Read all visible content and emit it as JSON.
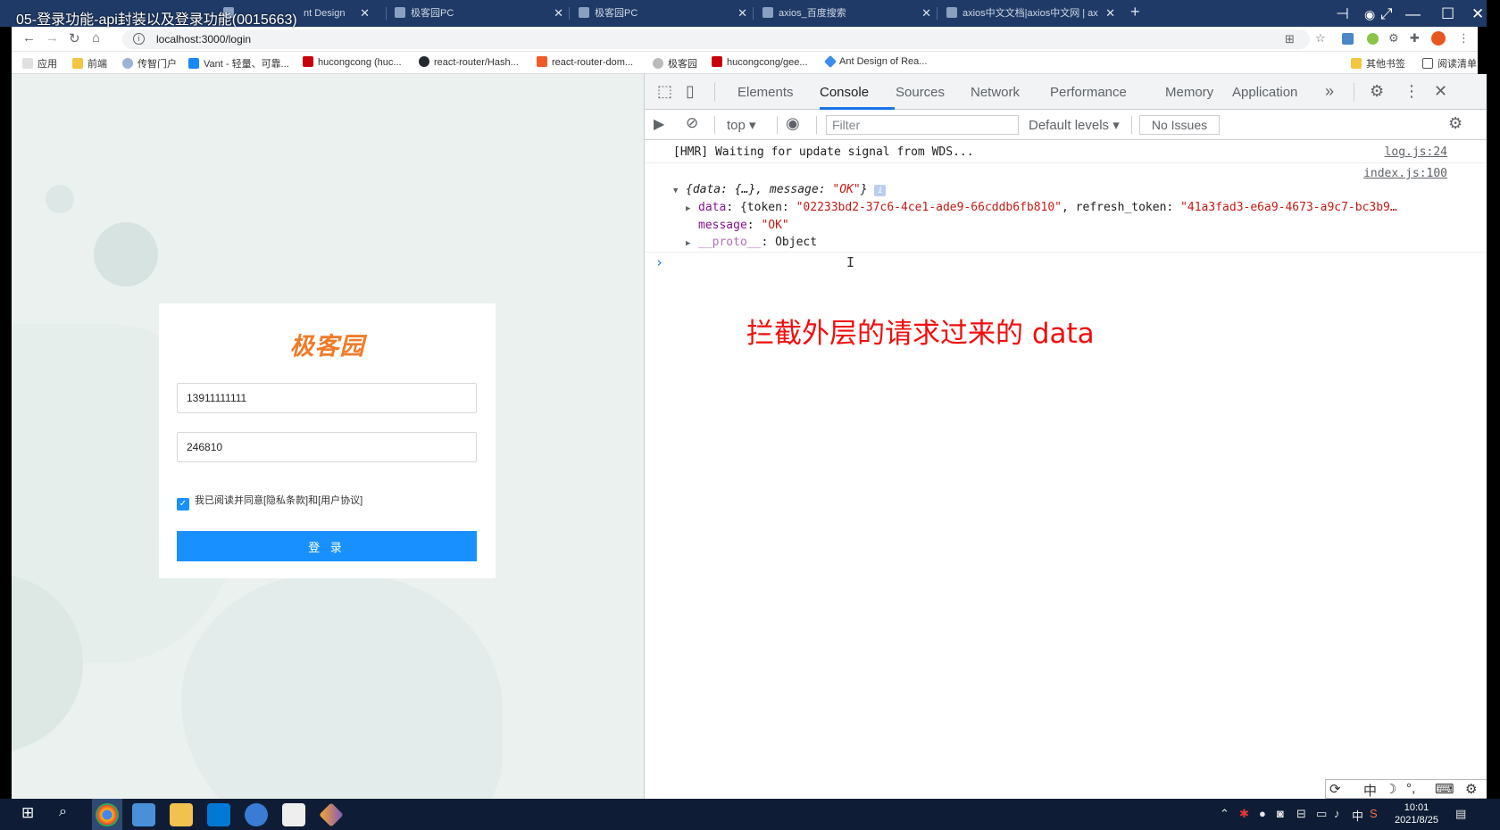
{
  "overlay_title": "05-登录功能-api封装以及登录功能(0015663)",
  "tabs": [
    {
      "label": "nt Design"
    },
    {
      "label": "极客园PC"
    },
    {
      "label": "极客园PC"
    },
    {
      "label": "axios_百度搜索"
    },
    {
      "label": "axios中文文档|axios中文网 | ax"
    }
  ],
  "address": {
    "url": "localhost:3000/login"
  },
  "bookmarks": [
    "应用",
    "前端",
    "传智门户",
    "Vant - 轻量、可靠...",
    "hucongcong (huc...",
    "react-router/Hash...",
    "react-router-dom...",
    "极客园",
    "hucongcong/gee...",
    "Ant Design of Rea...",
    "其他书签",
    "阅读清单"
  ],
  "login": {
    "logo": "极客园",
    "mobile": "13911111111",
    "code": "246810",
    "agreement": "我已阅读并同意[隐私条款]和[用户协议]",
    "submit": "登 录"
  },
  "devtools": {
    "tabs": [
      "Elements",
      "Console",
      "Sources",
      "Network",
      "Performance",
      "Memory",
      "Application"
    ],
    "context": "top",
    "filter_placeholder": "Filter",
    "levels": "Default levels",
    "issues": "No Issues"
  },
  "console": {
    "hmr_text": "[HMR] Waiting for update signal from WDS...",
    "hmr_src": "log.js:24",
    "obj_src": "index.js:100",
    "obj_open": "{data: {…}, message: ",
    "obj_msg": "\"OK\"",
    "obj_close": "}",
    "data_key": "data",
    "data_open": ": {token: ",
    "token": "\"02233bd2-37c6-4ce1-ade9-66cddb6fb810\"",
    "refresh_key": ", refresh_token: ",
    "refresh": "\"41a3fad3-e6a9-4673-a9c7-bc3b9…",
    "message_key": "message",
    "message_val": "\"OK\"",
    "proto_key": "__proto__",
    "proto_val": ": Object"
  },
  "annotation": "拦截外层的请求过来的 data",
  "ime": {
    "lang": "中"
  },
  "clock": {
    "time": "10:01",
    "date": "2021/8/25"
  }
}
